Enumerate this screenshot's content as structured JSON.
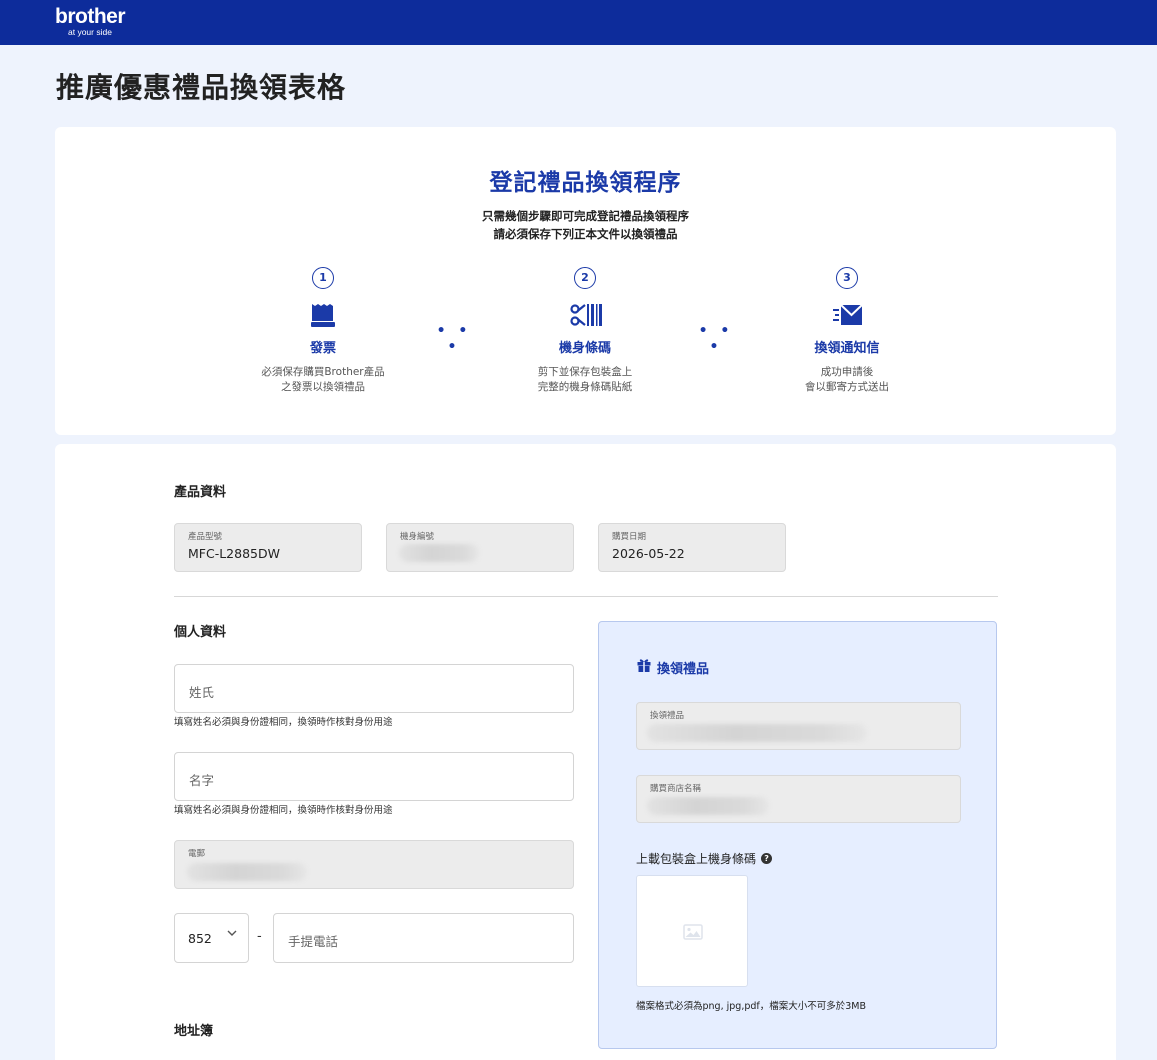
{
  "brand": {
    "name": "brother",
    "tagline": "at your side"
  },
  "page": {
    "title": "推廣優惠禮品換領表格"
  },
  "steps": {
    "title": "登記禮品換領程序",
    "subtitle_line1": "只需幾個步驟即可完成登記禮品換領程序",
    "subtitle_line2": "請必須保存下列正本文件以換領禮品",
    "items": [
      {
        "number": "1",
        "icon": "receipt-icon",
        "label": "發票",
        "desc_line1": "必須保存購買Brother產品",
        "desc_line2": "之發票以換領禮品"
      },
      {
        "number": "2",
        "icon": "scissors-barcode-icon",
        "label": "機身條碼",
        "desc_line1": "剪下並保存包裝盒上",
        "desc_line2": "完整的機身條碼貼紙"
      },
      {
        "number": "3",
        "icon": "email-sent-icon",
        "label": "換領通知信",
        "desc_line1": "成功申請後",
        "desc_line2": "會以郵寄方式送出"
      }
    ],
    "separator": "• • •"
  },
  "product": {
    "section_title": "產品資料",
    "model_label": "產品型號",
    "model_value": "MFC-L2885DW",
    "serial_label": "機身編號",
    "date_label": "購買日期",
    "date_value": "2026-05-22"
  },
  "personal": {
    "section_title": "個人資料",
    "surname_placeholder": "姓氏",
    "surname_hint": "填寫姓名必須與身份證相同，換領時作核對身份用途",
    "givenname_placeholder": "名字",
    "givenname_hint": "填寫姓名必須與身份證相同，換領時作核對身份用途",
    "email_label": "電郵",
    "country_code": "852",
    "phone_separator": "-",
    "phone_placeholder": "手提電話"
  },
  "address": {
    "section_title": "地址簿"
  },
  "gift": {
    "title": "換領禮品",
    "gift_label": "換領禮品",
    "shop_label": "購買商店名稱",
    "upload_label": "上載包裝盒上機身條碼",
    "file_hint": "檔案格式必須為png, jpg,pdf，檔案大小不可多於3MB"
  },
  "colors": {
    "topbar": "#0d2c9b",
    "accent": "#1b3aa8",
    "background": "#eef3fd",
    "panel": "#e6eeff"
  }
}
